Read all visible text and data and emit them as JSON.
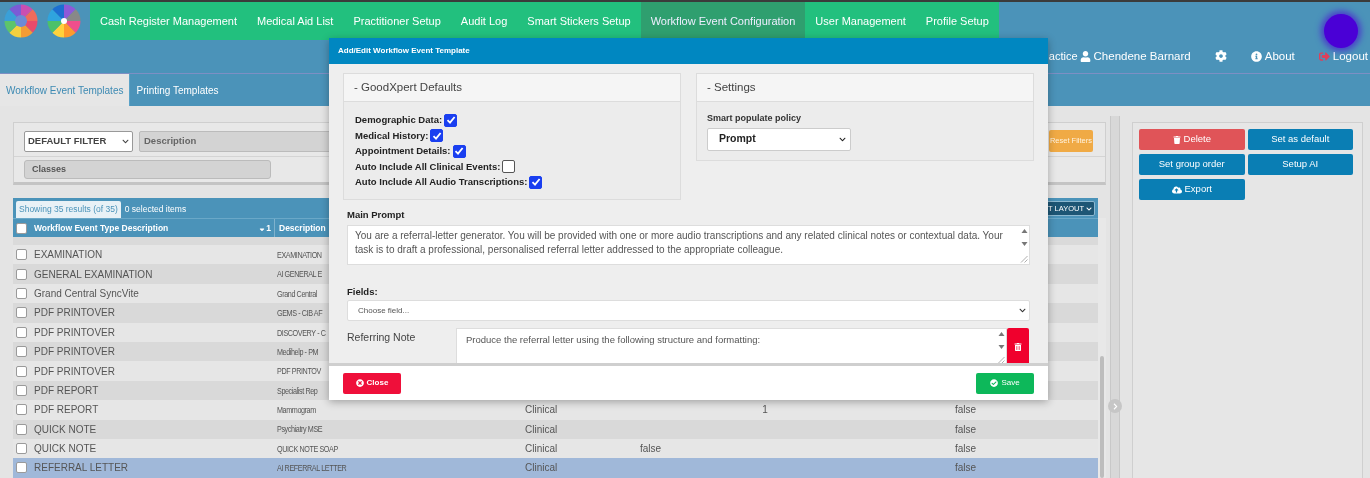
{
  "nav": {
    "items": [
      {
        "label": "Cash Register Management",
        "selected": false
      },
      {
        "label": "Medical Aid List",
        "selected": false
      },
      {
        "label": "Practitioner Setup",
        "selected": false
      },
      {
        "label": "Audit Log",
        "selected": false
      },
      {
        "label": "Smart Stickers Setup",
        "selected": false
      },
      {
        "label": "Workflow Event Configuration",
        "selected": true
      },
      {
        "label": "User Management",
        "selected": false
      },
      {
        "label": "Profile Setup",
        "selected": false
      }
    ]
  },
  "user_bar": {
    "practice": "actice",
    "user": "Chendene Barnard",
    "about": "About",
    "logout": "Logout"
  },
  "tabs": [
    {
      "label": "Workflow Event Templates",
      "selected": true
    },
    {
      "label": "Printing Templates",
      "selected": false
    }
  ],
  "filters": {
    "filter_select": "DEFAULT FILTER",
    "description_placeholder": "Description",
    "classes_placeholder": "Classes",
    "reset_button": "Reset Filters"
  },
  "table": {
    "all_checked": false,
    "results": "Showing 35 results (of 35)",
    "selected_count": "0 selected items",
    "layout_button": "T LAYOUT",
    "columns": [
      "Workflow Event Type Description",
      "Description"
    ],
    "sort_order": "1",
    "rows": [
      {
        "type": "EXAMINATION",
        "description": "EXAMINATION",
        "checked": false,
        "selected": false
      },
      {
        "type": "GENERAL EXAMINATION",
        "description": "AI GENERAL E",
        "checked": false,
        "selected": false
      },
      {
        "type": "Grand Central SyncVite",
        "description": "Grand Central",
        "checked": false,
        "selected": false
      },
      {
        "type": "PDF PRINTOVER",
        "description": "GEMS - CIB AF",
        "checked": false,
        "selected": false
      },
      {
        "type": "PDF PRINTOVER",
        "description": "DISCOVERY - C",
        "checked": false,
        "selected": false
      },
      {
        "type": "PDF PRINTOVER",
        "description": "Medihelp - PM",
        "checked": false,
        "selected": false
      },
      {
        "type": "PDF PRINTOVER",
        "description": "PDF PRINTOV",
        "checked": false,
        "selected": false
      },
      {
        "type": "PDF REPORT",
        "description": "Specialist Rep",
        "checked": false,
        "selected": false
      },
      {
        "type": "PDF REPORT",
        "description": "Mammogram",
        "column_3": "Clinical",
        "column_5": "1",
        "column_6": "false",
        "checked": false,
        "selected": false
      },
      {
        "type": "QUICK NOTE",
        "description": "Psychiatry MSE",
        "column_3": "Clinical",
        "column_6": "false",
        "checked": false,
        "selected": false
      },
      {
        "type": "QUICK NOTE",
        "description": "QUICK NOTE SOAP",
        "column_3": "Clinical",
        "column_4": "false",
        "column_6": "false",
        "checked": false,
        "selected": false
      },
      {
        "type": "REFERRAL LETTER",
        "description": "AI REFERRAL LETTER",
        "column_3": "Clinical",
        "column_6": "false",
        "checked": false,
        "selected": true
      }
    ]
  },
  "actions": [
    {
      "label": "Delete",
      "kind": "danger"
    },
    {
      "label": "Set as default",
      "kind": "primary"
    },
    {
      "label": "Set group order",
      "kind": "primary"
    },
    {
      "label": "Setup AI",
      "kind": "primary"
    },
    {
      "label": "Export",
      "kind": "export"
    }
  ],
  "modal": {
    "title": "Add/Edit Workflow Event Template",
    "defaults": {
      "title": "- GoodXpert Defaults",
      "options": [
        {
          "label": "Demographic Data:",
          "checked": true
        },
        {
          "label": "Medical History:",
          "checked": true
        },
        {
          "label": "Appointment Details:",
          "checked": true
        },
        {
          "label": "Auto Include All Clinical Events:",
          "checked": false
        },
        {
          "label": "Auto Include All Audio Transcriptions:",
          "checked": true
        }
      ]
    },
    "settings": {
      "title": "- Settings",
      "policy_label": "Smart populate policy",
      "policy_value": "Prompt"
    },
    "main_prompt": {
      "label": "Main Prompt",
      "value": "You are a referral-letter generator. You will be provided with one or more audio transcriptions and any related clinical notes or contextual data. Your task is to draft a professional, personalised referral letter addressed to the appropriate colleague."
    },
    "fields": {
      "label": "Fields:",
      "placeholder": "Choose field..."
    },
    "field_entries": [
      {
        "label": "Referring Note",
        "value": "Produce the referral letter using the following structure and formatting:"
      }
    ],
    "close_button": "Close",
    "save_button": "Save"
  }
}
